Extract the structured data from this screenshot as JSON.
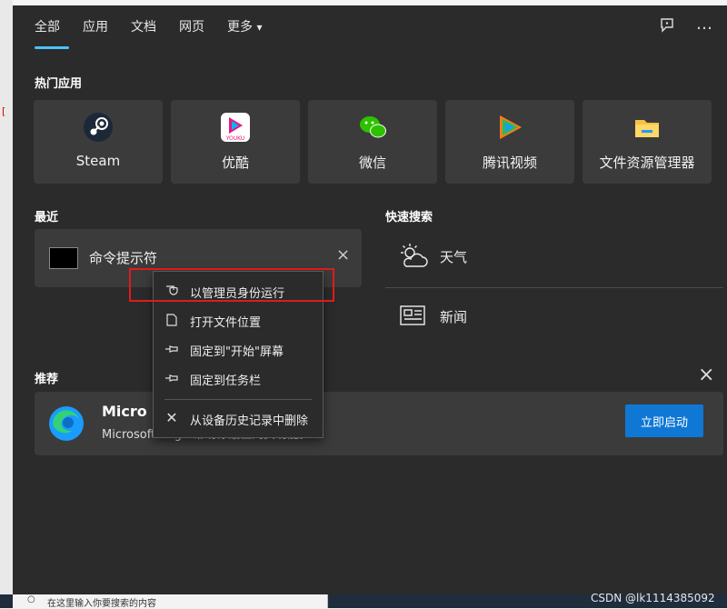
{
  "topnav": {
    "tabs": [
      "全部",
      "应用",
      "文档",
      "网页",
      "更多"
    ],
    "more_arrow": "▾",
    "feedback_icon": "feedback-icon",
    "more_icon": "…"
  },
  "hot_apps": {
    "title": "热门应用",
    "items": [
      {
        "label": "Steam",
        "icon": "steam-icon",
        "color": "#1b2838"
      },
      {
        "label": "优酷",
        "icon": "youku-icon",
        "color": "#ffffff"
      },
      {
        "label": "微信",
        "icon": "wechat-icon",
        "color": "#2dc100"
      },
      {
        "label": "腾讯视频",
        "icon": "tencent-video-icon",
        "color": "#ff7a1a"
      },
      {
        "label": "文件资源管理器",
        "icon": "folder-icon",
        "color": "#f5c242"
      }
    ]
  },
  "recent": {
    "title": "最近",
    "items": [
      {
        "label": "命令提示符",
        "icon": "cmd-icon"
      }
    ],
    "close_glyph": "×"
  },
  "quick_search": {
    "title": "快速搜索",
    "items": [
      {
        "label": "天气",
        "icon": "weather-icon"
      },
      {
        "label": "新闻",
        "icon": "news-icon"
      }
    ]
  },
  "recommend": {
    "title": "推荐",
    "close_glyph": "×",
    "app_name": "Micro",
    "description": "Microsoft Edge 帮助你最佳网页功能。",
    "button_label": "立即启动"
  },
  "context_menu": {
    "items": [
      {
        "label": "以管理员身份运行",
        "icon": "shield-icon"
      },
      {
        "label": "打开文件位置",
        "icon": "open-folder-icon"
      },
      {
        "label": "固定到\"开始\"屏幕",
        "icon": "pin-icon"
      },
      {
        "label": "固定到任务栏",
        "icon": "pin-icon"
      },
      {
        "label": "从设备历史记录中删除",
        "icon": "close-icon"
      }
    ]
  },
  "taskbar": {
    "search_placeholder": "在这里输入你要搜索的内容"
  },
  "watermark": "CSDN @lk1114385092",
  "colors": {
    "panel_bg": "#2b2b2b",
    "tile_bg": "#3b3b3b",
    "accent": "#4cc2ff",
    "button_blue": "#0f78d4",
    "highlight_red": "#e01b1b"
  }
}
